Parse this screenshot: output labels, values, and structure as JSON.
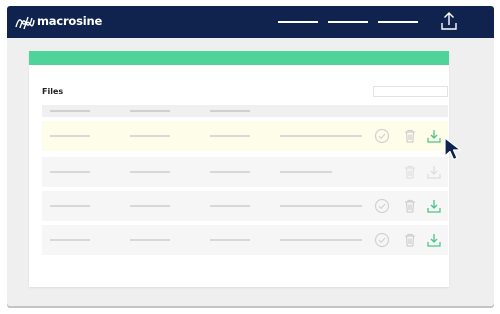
{
  "app": {
    "brand": "macrosine"
  },
  "header": {
    "nav_items": [
      "",
      "",
      ""
    ],
    "upload_icon": "upload-icon"
  },
  "colors": {
    "topbar": "#10234f",
    "accent": "#4ed49a",
    "download": "#4cc58a",
    "highlight_row": "#fdfdea"
  },
  "files": {
    "title": "Files",
    "search": {
      "placeholder": ""
    },
    "rows": [
      {
        "highlighted": true,
        "actions": [
          "check-circle-icon",
          "trash-icon",
          "download-icon"
        ]
      },
      {
        "highlighted": false,
        "actions": [
          "trash-icon",
          "download-icon"
        ],
        "disabled": true
      },
      {
        "highlighted": false,
        "actions": [
          "check-circle-icon",
          "trash-icon",
          "download-icon"
        ]
      },
      {
        "highlighted": false,
        "actions": [
          "check-circle-icon",
          "trash-icon",
          "download-icon"
        ]
      }
    ]
  }
}
